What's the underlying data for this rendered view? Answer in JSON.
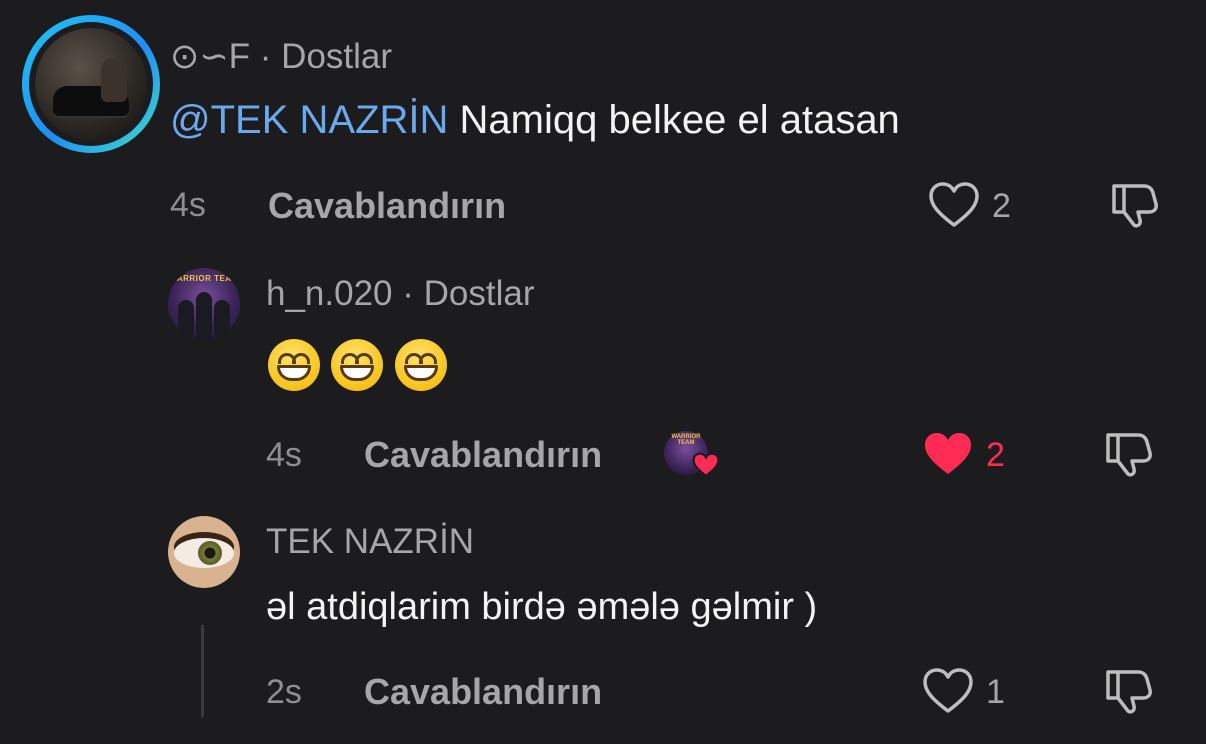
{
  "comment1": {
    "author_prefix": "⊙∽F",
    "separator": "·",
    "relation": "Dostlar",
    "mention": "@TEK NAZRİN",
    "text": "Namiqq belkee el atasan",
    "time": "4s",
    "reply_label": "Cavablandırın",
    "likes": "2",
    "liked": false
  },
  "comment2": {
    "author": "h_n.020",
    "separator": "·",
    "relation": "Dostlar",
    "avatar_label": "WARRIOR TEAM",
    "text_emoji_count": 3,
    "time": "4s",
    "reply_label": "Cavablandırın",
    "likes": "2",
    "liked": true
  },
  "comment3": {
    "author": "TEK NAZRİN",
    "text": "əl atdiqlarim birdə əmələ gəlmir )",
    "time": "2s",
    "reply_label": "Cavablandırın",
    "likes": "1",
    "liked": false
  },
  "colors": {
    "background": "#1c1c1e",
    "mention": "#6aa9ee",
    "liked_heart": "#fe2c55",
    "muted_text": "#a6a6aa"
  },
  "icons": [
    "heart-outline-icon",
    "heart-filled-icon",
    "dislike-icon"
  ]
}
